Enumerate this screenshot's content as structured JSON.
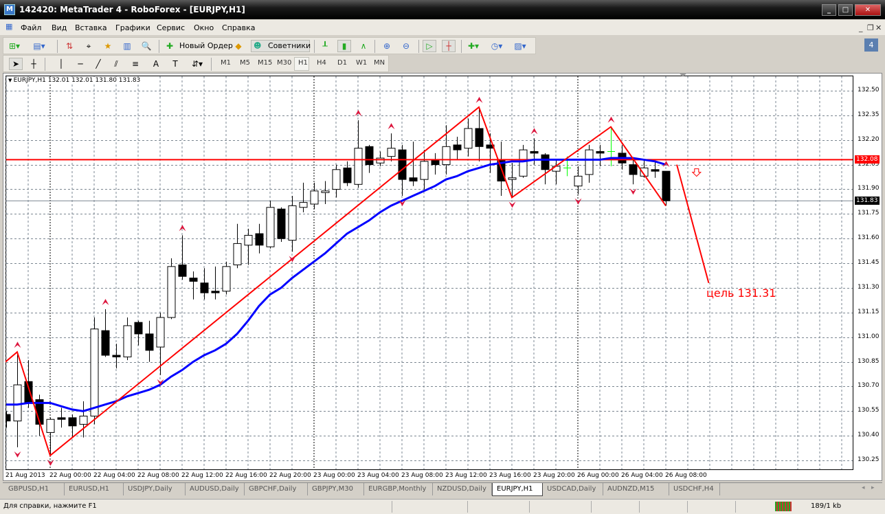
{
  "window": {
    "title": "142420: MetaTrader 4 - RoboForex - [EURJPY,H1]",
    "app_icon": "metatrader-icon"
  },
  "menu": [
    "Файл",
    "Вид",
    "Вставка",
    "Графики",
    "Сервис",
    "Окно",
    "Справка"
  ],
  "toolbar": {
    "new_order": "Новый Ордер",
    "experts": "Советники"
  },
  "timeframes": [
    "M1",
    "M5",
    "M15",
    "M30",
    "H1",
    "H4",
    "D1",
    "W1",
    "MN"
  ],
  "selected_timeframe": "H1",
  "chart_legend": "EURJPY,H1  132.01 132.01 131.80 131.83",
  "target_label": "цель 131.31",
  "colors": {
    "bull": "#ffffff",
    "bear": "#000000",
    "ma": "#0000ff",
    "zigzag": "#ff0000",
    "level": "#ff0000",
    "bid": "#000000",
    "grid": "#7a8590",
    "fractal": "#dc143c",
    "doji": "#00ff00"
  },
  "chart_data": {
    "type": "candlestick",
    "symbol": "EURJPY",
    "timeframe": "H1",
    "ylim": [
      130.2,
      132.575
    ],
    "price_ticks": [
      "132.50",
      "132.35",
      "132.20",
      "132.05",
      "131.90",
      "131.75",
      "131.60",
      "131.45",
      "131.30",
      "131.15",
      "131.00",
      "130.85",
      "130.70",
      "130.55",
      "130.40",
      "130.25"
    ],
    "time_labels": [
      {
        "bar": 0,
        "label": "21 Aug 2013"
      },
      {
        "bar": 4,
        "label": "22 Aug 00:00"
      },
      {
        "bar": 8,
        "label": "22 Aug 04:00"
      },
      {
        "bar": 12,
        "label": "22 Aug 08:00"
      },
      {
        "bar": 16,
        "label": "22 Aug 12:00"
      },
      {
        "bar": 20,
        "label": "22 Aug 16:00"
      },
      {
        "bar": 24,
        "label": "22 Aug 20:00"
      },
      {
        "bar": 28,
        "label": "23 Aug 00:00"
      },
      {
        "bar": 32,
        "label": "23 Aug 04:00"
      },
      {
        "bar": 36,
        "label": "23 Aug 08:00"
      },
      {
        "bar": 40,
        "label": "23 Aug 12:00"
      },
      {
        "bar": 44,
        "label": "23 Aug 16:00"
      },
      {
        "bar": 48,
        "label": "23 Aug 20:00"
      },
      {
        "bar": 52,
        "label": "26 Aug 00:00"
      },
      {
        "bar": 56,
        "label": "26 Aug 04:00"
      },
      {
        "bar": 60,
        "label": "26 Aug 08:00"
      }
    ],
    "day_separators": [
      4,
      28,
      52
    ],
    "ohlc": [
      [
        130.53,
        130.55,
        130.45,
        130.49
      ],
      [
        130.49,
        130.91,
        130.33,
        130.71
      ],
      [
        130.73,
        130.86,
        130.57,
        130.6
      ],
      [
        130.62,
        130.65,
        130.4,
        130.47
      ],
      [
        130.42,
        130.51,
        130.28,
        130.5
      ],
      [
        130.51,
        130.57,
        130.45,
        130.5
      ],
      [
        130.51,
        130.53,
        130.39,
        130.46
      ],
      [
        130.47,
        130.61,
        130.39,
        130.52
      ],
      [
        130.52,
        131.12,
        130.47,
        131.05
      ],
      [
        131.04,
        131.17,
        130.88,
        130.89
      ],
      [
        130.89,
        130.96,
        130.81,
        130.88
      ],
      [
        130.88,
        131.12,
        130.86,
        131.07
      ],
      [
        131.09,
        131.1,
        130.95,
        131.02
      ],
      [
        131.02,
        131.1,
        130.85,
        130.92
      ],
      [
        130.94,
        131.15,
        130.77,
        131.12
      ],
      [
        131.12,
        131.48,
        131.11,
        131.43
      ],
      [
        131.44,
        131.62,
        131.35,
        131.37
      ],
      [
        131.36,
        131.4,
        131.23,
        131.34
      ],
      [
        131.33,
        131.42,
        131.23,
        131.27
      ],
      [
        131.28,
        131.43,
        131.23,
        131.27
      ],
      [
        131.28,
        131.46,
        131.26,
        131.43
      ],
      [
        131.44,
        131.69,
        131.42,
        131.57
      ],
      [
        131.56,
        131.66,
        131.44,
        131.62
      ],
      [
        131.63,
        131.69,
        131.51,
        131.56
      ],
      [
        131.55,
        131.83,
        131.54,
        131.79
      ],
      [
        131.78,
        131.79,
        131.58,
        131.6
      ],
      [
        131.59,
        131.86,
        131.52,
        131.8
      ],
      [
        131.79,
        131.94,
        131.76,
        131.82
      ],
      [
        131.81,
        131.94,
        131.78,
        131.89
      ],
      [
        131.88,
        131.95,
        131.81,
        131.89
      ],
      [
        131.9,
        132.05,
        131.85,
        132.02
      ],
      [
        132.03,
        132.07,
        131.92,
        131.94
      ],
      [
        131.93,
        132.32,
        131.91,
        132.15
      ],
      [
        132.16,
        132.17,
        132.0,
        132.05
      ],
      [
        132.06,
        132.13,
        132.04,
        132.09
      ],
      [
        132.1,
        132.24,
        132.07,
        132.15
      ],
      [
        132.14,
        132.17,
        131.86,
        131.96
      ],
      [
        131.97,
        132.19,
        131.92,
        131.95
      ],
      [
        131.96,
        132.14,
        131.9,
        132.07
      ],
      [
        132.08,
        132.12,
        131.99,
        132.05
      ],
      [
        132.05,
        132.29,
        131.99,
        132.16
      ],
      [
        132.17,
        132.22,
        132.08,
        132.14
      ],
      [
        132.15,
        132.33,
        132.1,
        132.27
      ],
      [
        132.27,
        132.4,
        132.07,
        132.16
      ],
      [
        132.17,
        132.24,
        132.0,
        132.15
      ],
      [
        132.08,
        132.19,
        131.86,
        131.95
      ],
      [
        131.96,
        132.06,
        131.85,
        131.97
      ],
      [
        131.98,
        132.17,
        131.97,
        132.14
      ],
      [
        132.13,
        132.21,
        132.05,
        132.12
      ],
      [
        132.11,
        132.12,
        131.93,
        132.02
      ],
      [
        132.01,
        132.08,
        131.93,
        132.04
      ],
      [
        132.03,
        132.1,
        131.98,
        132.03
      ],
      [
        131.92,
        132.04,
        131.87,
        131.98
      ],
      [
        131.99,
        132.17,
        131.94,
        132.14
      ],
      [
        132.13,
        132.17,
        132.04,
        132.12
      ],
      [
        132.13,
        132.28,
        132.04,
        132.13
      ],
      [
        132.12,
        132.17,
        132.02,
        132.06
      ],
      [
        132.05,
        132.09,
        131.93,
        131.99
      ],
      [
        131.98,
        132.08,
        131.97,
        132.03
      ],
      [
        132.02,
        132.07,
        131.97,
        132.01
      ],
      [
        132.01,
        132.01,
        131.8,
        131.83
      ]
    ],
    "moving_average": [
      130.59,
      130.59,
      130.6,
      130.6,
      130.6,
      130.58,
      130.56,
      130.55,
      130.57,
      130.59,
      130.61,
      130.64,
      130.66,
      130.68,
      130.71,
      130.76,
      130.8,
      130.85,
      130.89,
      130.92,
      130.96,
      131.02,
      131.1,
      131.19,
      131.26,
      131.3,
      131.36,
      131.41,
      131.46,
      131.51,
      131.57,
      131.63,
      131.67,
      131.71,
      131.76,
      131.8,
      131.83,
      131.86,
      131.89,
      131.92,
      131.96,
      131.98,
      132.01,
      132.03,
      132.05,
      132.06,
      132.07,
      132.07,
      132.08,
      132.08,
      132.08,
      132.08,
      132.08,
      132.08,
      132.08,
      132.09,
      132.09,
      132.09,
      132.08,
      132.07,
      132.05
    ],
    "zigzag": [
      [
        -0.06,
        130.85
      ],
      [
        1,
        130.91
      ],
      [
        4,
        130.28
      ],
      [
        43,
        132.4
      ],
      [
        46,
        131.85
      ],
      [
        55,
        132.28
      ],
      [
        60,
        131.8
      ]
    ],
    "target_line": [
      [
        61,
        132.05
      ],
      [
        63.9,
        131.33
      ]
    ],
    "fractals_up": [
      1,
      9,
      16,
      32,
      35,
      43,
      48,
      55,
      60
    ],
    "fractals_down": [
      1,
      4,
      14,
      26,
      36,
      46,
      52,
      57
    ],
    "sell_arrow": {
      "bar": 62.8,
      "price": 132.0
    },
    "level_line": {
      "price": 132.08,
      "label": "132.08"
    },
    "bid_line": {
      "price": 131.83,
      "label": "131.83"
    }
  },
  "tabs": [
    "GBPUSD,H1",
    "EURUSD,H1",
    "USDJPY,Daily",
    "AUDUSD,Daily",
    "GBPCHF,Daily",
    "GBPJPY,M30",
    "EURGBP,Monthly",
    "NZDUSD,Daily",
    "EURJPY,H1",
    "USDCAD,Daily",
    "AUDNZD,M15",
    "USDCHF,H4"
  ],
  "active_tab": "EURJPY,H1",
  "status": {
    "help": "Для справки, нажмите F1",
    "traffic": "189/1 kb"
  }
}
